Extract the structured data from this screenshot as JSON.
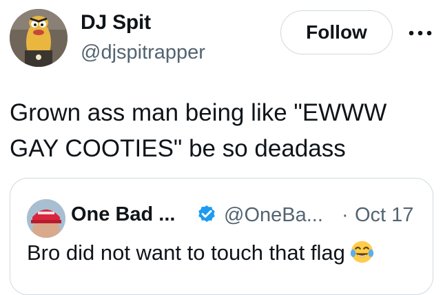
{
  "tweet": {
    "author": {
      "display_name": "DJ Spit",
      "handle": "@djspitrapper",
      "avatar_icon": "cartoon-character-avatar"
    },
    "follow_label": "Follow",
    "more_icon": "more-horizontal-icon",
    "text": "Grown ass man being like \"EWWW\nGAY COOTIES\" be so deadass"
  },
  "quote": {
    "author": {
      "display_name": "One Bad ...",
      "handle": "@OneBa...",
      "verified": true,
      "avatar_icon": "red-cap-avatar"
    },
    "separator": "·",
    "date": "Oct 17",
    "text": "Bro did not want to touch that flag",
    "emoji": "face-with-tears-of-joy-icon"
  },
  "colors": {
    "text_primary": "#0f1419",
    "text_secondary": "#536471",
    "border": "#cfd9de",
    "verified_blue": "#1d9bf0"
  }
}
